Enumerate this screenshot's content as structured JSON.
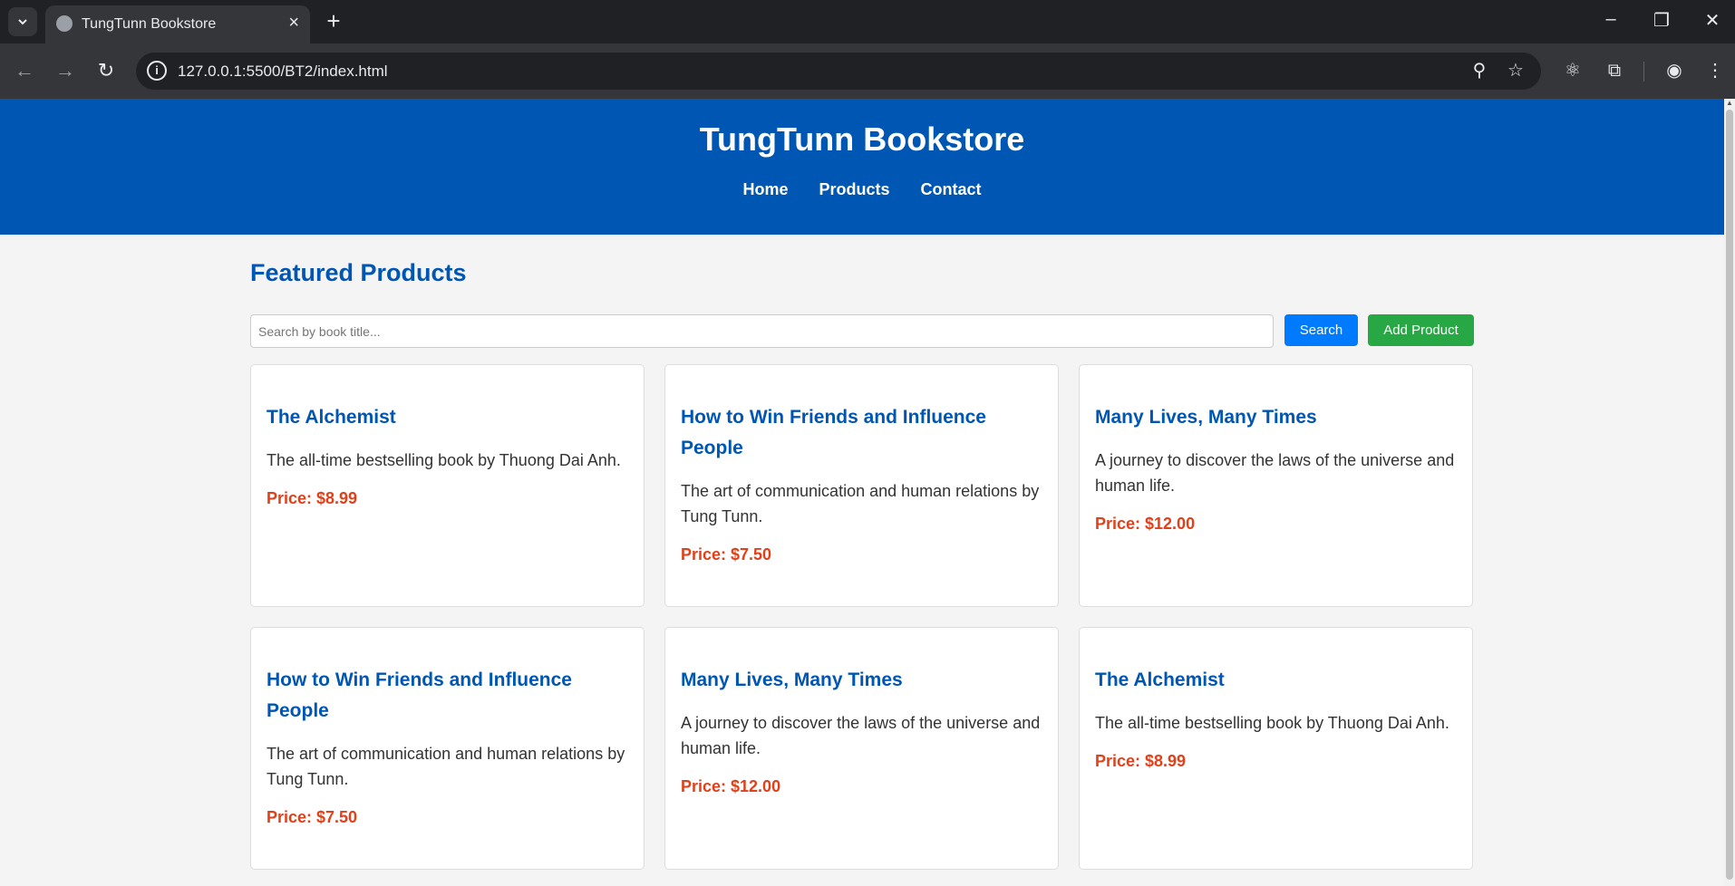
{
  "browser": {
    "tab_title": "TungTunn Bookstore",
    "url": "127.0.0.1:5500/BT2/index.html"
  },
  "icons": {
    "tab_list": "chevron-down-icon",
    "favicon": "globe-icon",
    "tab_close": "close-icon",
    "new_tab": "plus-icon",
    "back": "arrow-left-icon",
    "forward": "arrow-right-icon",
    "reload": "reload-icon",
    "site_info": "info-icon",
    "zoom": "zoom-out-icon",
    "bookmark": "star-icon",
    "react": "react-icon",
    "extensions": "puzzle-icon",
    "profile": "account-icon",
    "menu": "kebab-menu-icon",
    "minimize": "minimize-icon",
    "restore": "restore-icon",
    "close_window": "close-icon"
  },
  "header": {
    "title": "TungTunn Bookstore",
    "nav": [
      "Home",
      "Products",
      "Contact"
    ]
  },
  "main": {
    "section_title": "Featured Products",
    "search": {
      "placeholder": "Search by book title...",
      "value": ""
    },
    "buttons": {
      "search": "Search",
      "add_product": "Add Product"
    },
    "products": [
      {
        "title": "The Alchemist",
        "description": "The all-time bestselling book by Thuong Dai Anh.",
        "price": "Price: $8.99"
      },
      {
        "title": "How to Win Friends and Influence People",
        "description": "The art of communication and human relations by Tung Tunn.",
        "price": "Price: $7.50"
      },
      {
        "title": "Many Lives, Many Times",
        "description": "A journey to discover the laws of the universe and human life.",
        "price": "Price: $12.00"
      },
      {
        "title": "How to Win Friends and Influence People",
        "description": "The art of communication and human relations by Tung Tunn.",
        "price": "Price: $7.50"
      },
      {
        "title": "Many Lives, Many Times",
        "description": "A journey to discover the laws of the universe and human life.",
        "price": "Price: $12.00"
      },
      {
        "title": "The Alchemist",
        "description": "The all-time bestselling book by Thuong Dai Anh.",
        "price": "Price: $8.99"
      }
    ]
  },
  "colors": {
    "header_bg": "#0056b3",
    "accent": "#0056b3",
    "price": "#e0401a",
    "search_btn": "#007bff",
    "add_btn": "#28a745"
  }
}
